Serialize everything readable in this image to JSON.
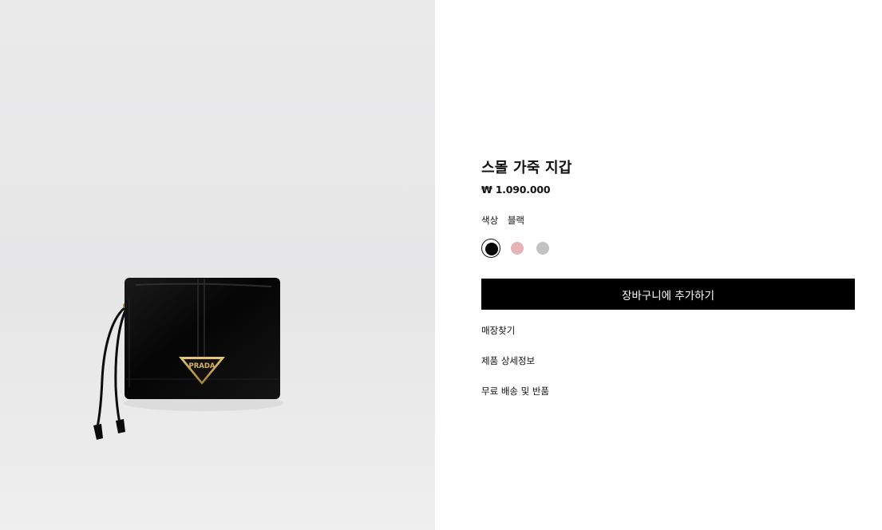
{
  "product": {
    "title": "스몰 가죽 지갑",
    "price": "₩ 1.090.000",
    "image_alt": "Black leather wallet with triangle logo",
    "logo_text": "PRADA"
  },
  "color": {
    "label": "색상",
    "selected_name": "블랙",
    "options": [
      {
        "name": "black",
        "hex": "#000000",
        "selected": true
      },
      {
        "name": "pink",
        "hex": "#e5b3b8",
        "selected": false
      },
      {
        "name": "silver",
        "hex": "#c2c2c2",
        "selected": false
      }
    ]
  },
  "actions": {
    "add_to_cart": "장바구니에 추가하기"
  },
  "links": {
    "find_store": "매장찾기",
    "product_details": "제품 상세정보",
    "free_shipping_returns": "무료 배송 및 반품"
  }
}
